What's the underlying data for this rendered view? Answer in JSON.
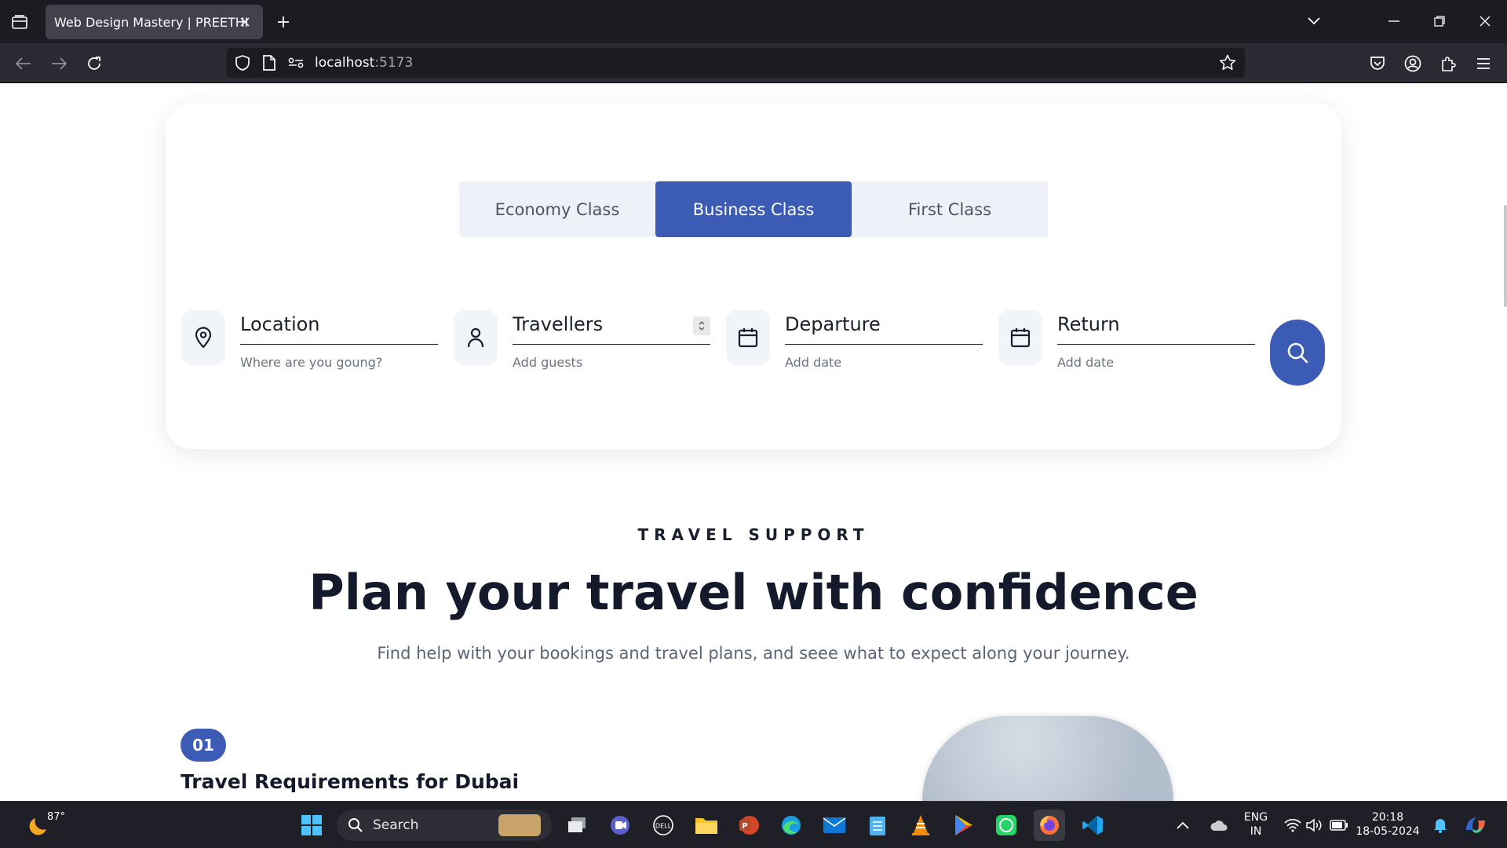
{
  "browser": {
    "tab_title": "Web Design Mastery | PREETHI",
    "url_host": "localhost",
    "url_port": ":5173"
  },
  "booking": {
    "class_tabs": [
      {
        "label": "Economy Class",
        "active": false
      },
      {
        "label": "Business Class",
        "active": true
      },
      {
        "label": "First Class",
        "active": false
      }
    ],
    "fields": [
      {
        "label": "Location",
        "hint": "Where are you goung?",
        "icon": "location-pin-icon"
      },
      {
        "label": "Travellers",
        "hint": "Add guests",
        "icon": "user-icon"
      },
      {
        "label": "Departure",
        "hint": "Add date",
        "icon": "calendar-icon"
      },
      {
        "label": "Return",
        "hint": "Add date",
        "icon": "calendar-icon"
      }
    ],
    "accent_color": "#3b5bb5"
  },
  "support": {
    "eyebrow": "TRAVEL SUPPORT",
    "headline": "Plan your travel with confidence",
    "subline": "Find help with your bookings and travel plans, and seee what to expect along your journey.",
    "item_number": "01",
    "item_title": "Travel Requirements for Dubai"
  },
  "taskbar": {
    "weather": "87°",
    "search_label": "Search",
    "lang_line1": "ENG",
    "lang_line2": "IN",
    "time": "20:18",
    "date": "18-05-2024"
  }
}
